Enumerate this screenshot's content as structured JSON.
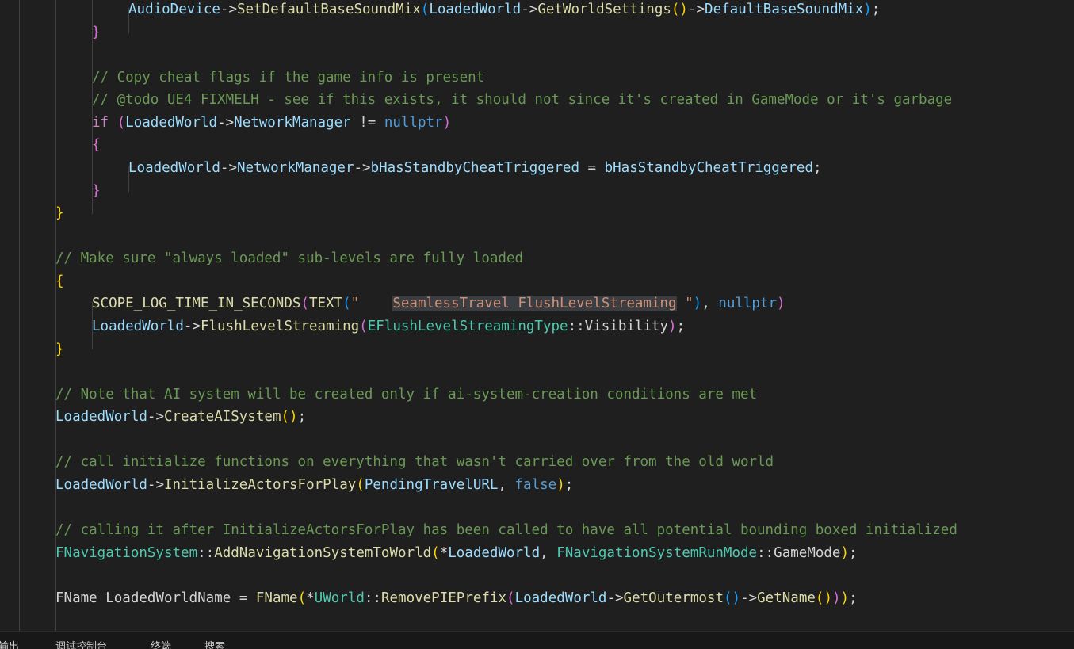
{
  "editor": {
    "lines": [
      {
        "indent": 3,
        "tokens": [
          {
            "t": "AudioDevice",
            "c": "var"
          },
          {
            "t": "->",
            "c": "op"
          },
          {
            "t": "SetDefaultBaseSoundMix",
            "c": "fn"
          },
          {
            "t": "(",
            "c": "b3"
          },
          {
            "t": "LoadedWorld",
            "c": "var"
          },
          {
            "t": "->",
            "c": "op"
          },
          {
            "t": "GetWorldSettings",
            "c": "fn"
          },
          {
            "t": "()",
            "c": "b1"
          },
          {
            "t": "->",
            "c": "op"
          },
          {
            "t": "DefaultBaseSoundMix",
            "c": "var"
          },
          {
            "t": ")",
            "c": "b3"
          },
          {
            "t": ";",
            "c": "op"
          }
        ]
      },
      {
        "indent": 2,
        "tokens": [
          {
            "t": "}",
            "c": "b2"
          }
        ]
      },
      {
        "indent": 0,
        "tokens": []
      },
      {
        "indent": 2,
        "tokens": [
          {
            "t": "// Copy cheat flags if the game info is present",
            "c": "cm"
          }
        ]
      },
      {
        "indent": 2,
        "tokens": [
          {
            "t": "// @todo UE4 FIXMELH - see if this exists, it should not since it's created in GameMode or it's garbage",
            "c": "cm"
          }
        ]
      },
      {
        "indent": 2,
        "tokens": [
          {
            "t": "if",
            "c": "ctrl"
          },
          {
            "t": " ",
            "c": "plain"
          },
          {
            "t": "(",
            "c": "b2"
          },
          {
            "t": "LoadedWorld",
            "c": "var"
          },
          {
            "t": "->",
            "c": "op"
          },
          {
            "t": "NetworkManager",
            "c": "var"
          },
          {
            "t": " != ",
            "c": "op"
          },
          {
            "t": "nullptr",
            "c": "kw"
          },
          {
            "t": ")",
            "c": "b2"
          }
        ]
      },
      {
        "indent": 2,
        "tokens": [
          {
            "t": "{",
            "c": "b2"
          }
        ]
      },
      {
        "indent": 3,
        "tokens": [
          {
            "t": "LoadedWorld",
            "c": "var"
          },
          {
            "t": "->",
            "c": "op"
          },
          {
            "t": "NetworkManager",
            "c": "var"
          },
          {
            "t": "->",
            "c": "op"
          },
          {
            "t": "bHasStandbyCheatTriggered",
            "c": "var"
          },
          {
            "t": " = ",
            "c": "op"
          },
          {
            "t": "bHasStandbyCheatTriggered",
            "c": "var"
          },
          {
            "t": ";",
            "c": "op"
          }
        ]
      },
      {
        "indent": 2,
        "tokens": [
          {
            "t": "}",
            "c": "b2"
          }
        ]
      },
      {
        "indent": 1,
        "tokens": [
          {
            "t": "}",
            "c": "b1"
          }
        ]
      },
      {
        "indent": 0,
        "tokens": []
      },
      {
        "indent": 1,
        "tokens": [
          {
            "t": "// Make sure \"always loaded\" sub-levels are fully loaded",
            "c": "cm"
          }
        ]
      },
      {
        "indent": 1,
        "tokens": [
          {
            "t": "{",
            "c": "b1"
          }
        ]
      },
      {
        "indent": 2,
        "tokens": [
          {
            "t": "SCOPE_LOG_TIME_IN_SECONDS",
            "c": "macro"
          },
          {
            "t": "(",
            "c": "b2"
          },
          {
            "t": "TEXT",
            "c": "macro"
          },
          {
            "t": "(",
            "c": "b3"
          },
          {
            "t": "\"    ",
            "c": "str"
          },
          {
            "t": "SeamlessTravel FlushLevelStreaming",
            "c": "hl"
          },
          {
            "t": " \"",
            "c": "str"
          },
          {
            "t": ")",
            "c": "b3"
          },
          {
            "t": ", ",
            "c": "op"
          },
          {
            "t": "nullptr",
            "c": "kw"
          },
          {
            "t": ")",
            "c": "b2"
          }
        ]
      },
      {
        "indent": 2,
        "tokens": [
          {
            "t": "LoadedWorld",
            "c": "var"
          },
          {
            "t": "->",
            "c": "op"
          },
          {
            "t": "FlushLevelStreaming",
            "c": "fn"
          },
          {
            "t": "(",
            "c": "b2"
          },
          {
            "t": "EFlushLevelStreamingType",
            "c": "type"
          },
          {
            "t": "::",
            "c": "op"
          },
          {
            "t": "Visibility",
            "c": "plain"
          },
          {
            "t": ")",
            "c": "b2"
          },
          {
            "t": ";",
            "c": "op"
          }
        ]
      },
      {
        "indent": 1,
        "tokens": [
          {
            "t": "}",
            "c": "b1"
          }
        ]
      },
      {
        "indent": 0,
        "tokens": []
      },
      {
        "indent": 1,
        "tokens": [
          {
            "t": "// Note that AI system will be created only if ai-system-creation conditions are met",
            "c": "cm"
          }
        ]
      },
      {
        "indent": 1,
        "tokens": [
          {
            "t": "LoadedWorld",
            "c": "var"
          },
          {
            "t": "->",
            "c": "op"
          },
          {
            "t": "CreateAISystem",
            "c": "fn"
          },
          {
            "t": "()",
            "c": "b1"
          },
          {
            "t": ";",
            "c": "op"
          }
        ]
      },
      {
        "indent": 0,
        "tokens": []
      },
      {
        "indent": 1,
        "tokens": [
          {
            "t": "// call initialize functions on everything that wasn't carried over from the old world",
            "c": "cm"
          }
        ]
      },
      {
        "indent": 1,
        "tokens": [
          {
            "t": "LoadedWorld",
            "c": "var"
          },
          {
            "t": "->",
            "c": "op"
          },
          {
            "t": "InitializeActorsForPlay",
            "c": "fn"
          },
          {
            "t": "(",
            "c": "b1"
          },
          {
            "t": "PendingTravelURL",
            "c": "var"
          },
          {
            "t": ", ",
            "c": "op"
          },
          {
            "t": "false",
            "c": "kw"
          },
          {
            "t": ")",
            "c": "b1"
          },
          {
            "t": ";",
            "c": "op"
          }
        ]
      },
      {
        "indent": 0,
        "tokens": []
      },
      {
        "indent": 1,
        "tokens": [
          {
            "t": "// calling it after InitializeActorsForPlay has been called to have all potential bounding boxed initialized",
            "c": "cm"
          }
        ]
      },
      {
        "indent": 1,
        "tokens": [
          {
            "t": "FNavigationSystem",
            "c": "type"
          },
          {
            "t": "::",
            "c": "op"
          },
          {
            "t": "AddNavigationSystemToWorld",
            "c": "fn"
          },
          {
            "t": "(",
            "c": "b1"
          },
          {
            "t": "*",
            "c": "op"
          },
          {
            "t": "LoadedWorld",
            "c": "var"
          },
          {
            "t": ", ",
            "c": "op"
          },
          {
            "t": "FNavigationSystemRunMode",
            "c": "type"
          },
          {
            "t": "::",
            "c": "op"
          },
          {
            "t": "GameMode",
            "c": "plain"
          },
          {
            "t": ")",
            "c": "b1"
          },
          {
            "t": ";",
            "c": "op"
          }
        ]
      },
      {
        "indent": 0,
        "tokens": []
      },
      {
        "indent": 1,
        "tokens": [
          {
            "t": "FName",
            "c": "plain"
          },
          {
            "t": " ",
            "c": "plain"
          },
          {
            "t": "LoadedWorldName",
            "c": "plain"
          },
          {
            "t": " = ",
            "c": "op"
          },
          {
            "t": "FName",
            "c": "fn"
          },
          {
            "t": "(",
            "c": "b1"
          },
          {
            "t": "*",
            "c": "op"
          },
          {
            "t": "UWorld",
            "c": "type"
          },
          {
            "t": "::",
            "c": "op"
          },
          {
            "t": "RemovePIEPrefix",
            "c": "fn"
          },
          {
            "t": "(",
            "c": "b2"
          },
          {
            "t": "LoadedWorld",
            "c": "var"
          },
          {
            "t": "->",
            "c": "op"
          },
          {
            "t": "GetOutermost",
            "c": "fn"
          },
          {
            "t": "()",
            "c": "b3"
          },
          {
            "t": "->",
            "c": "op"
          },
          {
            "t": "GetName",
            "c": "fn"
          },
          {
            "t": "()",
            "c": "b1"
          },
          {
            "t": ")",
            "c": "b2"
          },
          {
            "t": ")",
            "c": "b1"
          },
          {
            "t": ";",
            "c": "op"
          }
        ]
      }
    ]
  },
  "panel": {
    "tabs": [
      "输出",
      "调试控制台",
      "终端",
      "搜索"
    ]
  }
}
